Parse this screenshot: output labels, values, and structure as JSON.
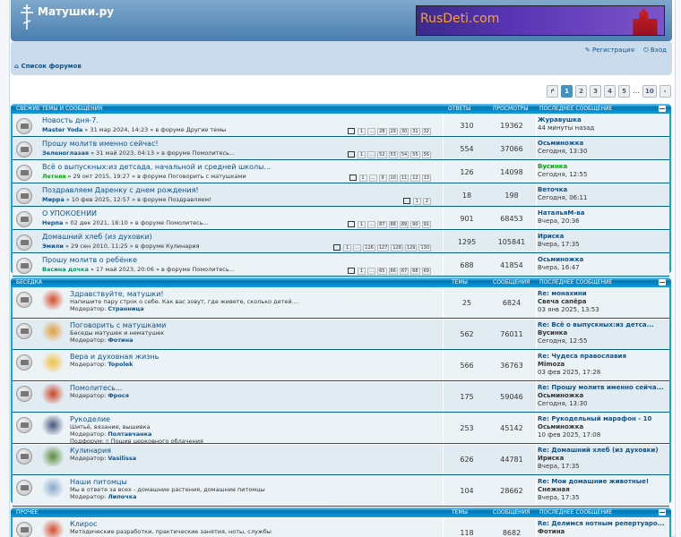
{
  "site": {
    "title": "Матушки.ру",
    "banner": "RusDeti.com"
  },
  "nav": {
    "register": "Регистрация",
    "login": "Вход",
    "breadcrumb": "Список форумов"
  },
  "pagination": [
    "1",
    "2",
    "3",
    "4",
    "5",
    "…",
    "10"
  ],
  "recent": {
    "header": {
      "title": "Свежие темы и сообщения",
      "replies": "Ответы",
      "views": "Просмотры",
      "last": "Последнее сообщение"
    },
    "rows": [
      {
        "title": "Новость дня-7.",
        "author": "Master Yoda",
        "info": " » 31 мар 2024, 14:23 » в форуме Другие темы",
        "pages": [
          "1",
          "…",
          "28",
          "29",
          "30",
          "31",
          "32"
        ],
        "replies": "310",
        "views": "19362",
        "last_author": "Журавушка",
        "last_time": "44 минуты назад"
      },
      {
        "title": "Прошу молитв именно сейчас!",
        "author": "Зеленоглазая",
        "info": " » 31 май 2023, 04:13 » в форуме Помолитесь...",
        "pages": [
          "1",
          "…",
          "52",
          "53",
          "54",
          "55",
          "56"
        ],
        "replies": "554",
        "views": "37066",
        "last_author": "Осьминожка",
        "last_time": "Сегодня, 13:30"
      },
      {
        "title": "Всё о выпускных:из детсада, начальной и средней школы...",
        "author": "Летняя",
        "info": " » 29 окт 2015, 19:27 » в форуме Поговорить с матушками",
        "pages": [
          "1",
          "…",
          "9",
          "10",
          "11",
          "12",
          "13"
        ],
        "replies": "126",
        "views": "14098",
        "last_author": "Вусинка",
        "last_time": "Сегодня, 12:55"
      },
      {
        "title": "Поздравляем Даренку с днем рождения!",
        "author": "Мирра",
        "info": " » 10 фев 2025, 12:57 » в форуме Поздравляем!",
        "pages": [
          "1",
          "2"
        ],
        "replies": "18",
        "views": "198",
        "last_author": "Веточка",
        "last_time": "Сегодня, 06:11"
      },
      {
        "title": "О УПОКОЕНИИ",
        "author": "Нерпа",
        "info": " » 02 дек 2021, 18:10 » в форуме Помолитесь...",
        "pages": [
          "1",
          "…",
          "87",
          "88",
          "89",
          "90",
          "91"
        ],
        "replies": "901",
        "views": "68453",
        "last_author": "НатальяМ-ва",
        "last_time": "Вчера, 20:36"
      },
      {
        "title": "Домашний хлеб (из духовки)",
        "author": "Эмили",
        "info": " » 29 сен 2010, 11:25 » в форуме Кулинария",
        "pages": [
          "1",
          "…",
          "126",
          "127",
          "128",
          "129",
          "130"
        ],
        "replies": "1295",
        "views": "105841",
        "last_author": "Ириска",
        "last_time": "Вчера, 17:35"
      },
      {
        "title": "Прошу молитв о ребёнке",
        "author": "Васина дочка",
        "info": " » 17 май 2023, 20:06 » в форуме Помолитесь...",
        "pages": [
          "1",
          "…",
          "65",
          "66",
          "67",
          "68",
          "69"
        ],
        "replies": "688",
        "views": "41854",
        "last_author": "Осьминожка",
        "last_time": "Вчера, 16:47"
      }
    ]
  },
  "besedka": {
    "header": {
      "title": "Беседка",
      "topics": "Темы",
      "posts": "Сообщения",
      "last": "Последнее сообщение"
    },
    "rows": [
      {
        "title": "Здравствуйте, матушки!",
        "desc": "Напишите пару строк о себе. Как вас зовут, где живете, сколько детей....",
        "modlabel": "Модератор:",
        "mod": "Странница",
        "topics": "25",
        "posts": "6824",
        "last_title": "Re: монахини",
        "last_author": "Свеча сапёра",
        "last_time": "03 янв 2025, 13:53"
      },
      {
        "title": "Поговорить с матушками",
        "desc": "Беседы матушек и нематушек",
        "modlabel": "Модератор:",
        "mod": "Фотина",
        "topics": "562",
        "posts": "76011",
        "last_title": "Re: Всё о выпускных:из детса...",
        "last_author": "Вусинка",
        "last_time": "Сегодня, 12:55"
      },
      {
        "title": "Вера и духовная жизнь",
        "desc": "",
        "modlabel": "Модератор:",
        "mod": "Topolek",
        "topics": "566",
        "posts": "36763",
        "last_title": "Re: Чудеса православия",
        "last_author": "Mimoza",
        "last_time": "03 фев 2025, 17:28"
      },
      {
        "title": "Помолитесь...",
        "desc": "",
        "modlabel": "Модератор:",
        "mod": "Фрося",
        "topics": "175",
        "posts": "59046",
        "last_title": "Re: Прошу молитв именно сейча...",
        "last_author": "Осьминожка",
        "last_time": "Сегодня, 13:30"
      },
      {
        "title": "Рукоделие",
        "desc": "Шитьё, вязание, вышивка",
        "modlabel": "Модератор:",
        "mod": "Полтавчанка",
        "sublabel": "Подфорум:",
        "sub": "Пошив церковного облачения",
        "topics": "253",
        "posts": "45142",
        "last_title": "Re: Рукодельный марафон - 10",
        "last_author": "Осьминожка",
        "last_time": "10 фев 2025, 17:08"
      },
      {
        "title": "Кулинария",
        "desc": "",
        "modlabel": "Модератор:",
        "mod": "Vasilissa",
        "topics": "626",
        "posts": "44781",
        "last_title": "Re: Домашний хлеб (из духовки)",
        "last_author": "Ириска",
        "last_time": "Вчера, 17:35"
      },
      {
        "title": "Наши питомцы",
        "desc": "Мы в ответе за всех - домашние растения, домашние питомцы",
        "modlabel": "Модератор:",
        "mod": "Липочка",
        "topics": "104",
        "posts": "28662",
        "last_title": "Re: Мои домашние животные!",
        "last_author": "Снежная",
        "last_time": "Вчера, 17:35"
      }
    ]
  },
  "prochee": {
    "header": {
      "title": "Прочее",
      "topics": "Темы",
      "posts": "Сообщения",
      "last": "Последнее сообщение"
    },
    "rows": [
      {
        "title": "Клирос",
        "desc": "Методические разработки, практические занятия, ноты, службы",
        "topics": "118",
        "posts": "8682",
        "last_title": "Re: Делимся нотным репертуаро...",
        "last_author": "Фотина"
      }
    ]
  }
}
